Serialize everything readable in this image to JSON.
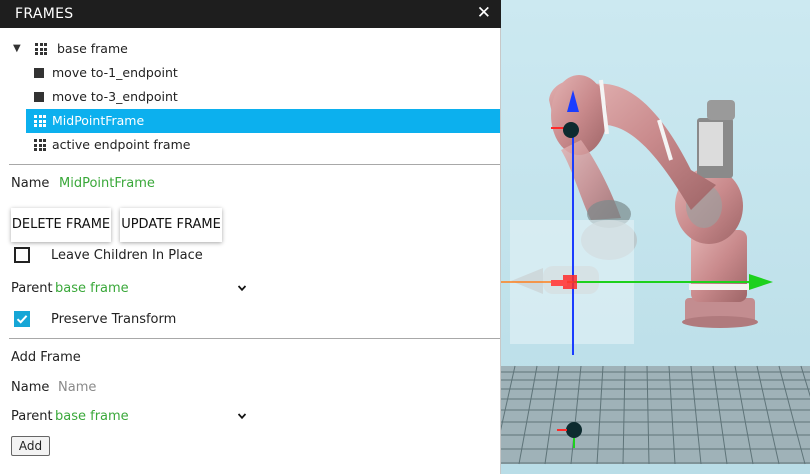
{
  "panel": {
    "title": "FRAMES",
    "close_icon": "close-icon"
  },
  "tree": {
    "items": [
      {
        "label": "base frame",
        "icon": "grid-frame-icon",
        "expanded": true
      },
      {
        "label": "move to-1_endpoint",
        "icon": "square-frame-icon"
      },
      {
        "label": "move to-3_endpoint",
        "icon": "square-frame-icon"
      },
      {
        "label": "MidPointFrame",
        "icon": "grid-frame-icon",
        "selected": true
      },
      {
        "label": "active endpoint frame",
        "icon": "grid-frame-icon"
      }
    ]
  },
  "details": {
    "name_label": "Name",
    "name_value": "MidPointFrame",
    "delete_button": "DELETE FRAME",
    "update_button": "UPDATE FRAME",
    "leave_children_label": "Leave Children In Place",
    "leave_children_checked": false,
    "parent_label": "Parent",
    "parent_value": "base frame",
    "preserve_transform_label": "Preserve Transform",
    "preserve_transform_checked": true
  },
  "add_frame": {
    "heading": "Add Frame",
    "name_label": "Name",
    "name_placeholder": "Name",
    "parent_label": "Parent",
    "parent_value": "base frame",
    "add_button": "Add"
  },
  "colors": {
    "accent": "#0cb0ee",
    "value_green": "#3aa83a",
    "titlebar": "#1e1e1e",
    "viewport_bg": "#c8e6ee"
  }
}
